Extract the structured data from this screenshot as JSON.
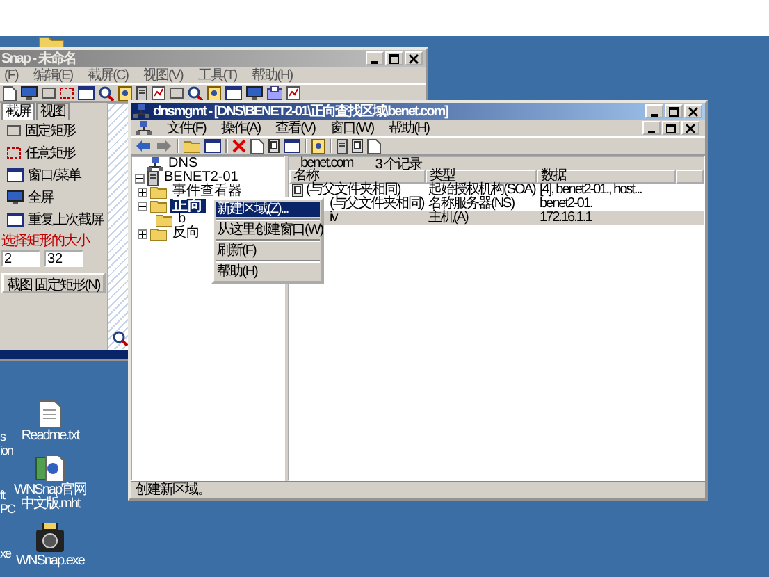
{
  "back_window": {
    "title": "Snap - 未命名",
    "menu": [
      "(F)",
      "编辑(E)",
      "截屏(C)",
      "视图(V)",
      "工具(T)",
      "帮助(H)"
    ],
    "tabs": [
      {
        "label": "截屏",
        "selected": true
      },
      {
        "label": "视图",
        "selected": false
      }
    ],
    "capture_items": [
      "固定矩形",
      "任意矩形",
      "窗口/菜单",
      "全屏",
      "重复上次截屏"
    ],
    "size_label": "选择矩形的大小",
    "width_value": "2",
    "height_value": "32",
    "capture_button": "截图 固定矩形(N)"
  },
  "dns_window": {
    "title": "dnsmgmt - [DNS\\BENET2-01\\正向查找区域\\benet.com]",
    "menu": [
      "文件(F)",
      "操作(A)",
      "查看(V)",
      "窗口(W)",
      "帮助(H)"
    ],
    "tree": [
      {
        "label": "DNS",
        "selected": false,
        "children": [
          {
            "label": "BENET2-01",
            "selected": false,
            "expanded": true,
            "children": [
              {
                "label": "事件查看器",
                "selected": false,
                "expanded": false
              },
              {
                "label": "正向",
                "selected": true,
                "expanded": true,
                "children": [
                  {
                    "label": "b",
                    "selected": false
                  }
                ]
              },
              {
                "label": "反向",
                "selected": false,
                "expanded": false
              }
            ]
          }
        ]
      }
    ],
    "list_header": "benet.com",
    "record_count": "3 个记录",
    "columns": [
      "名称",
      "类型",
      "数据"
    ],
    "rows": [
      {
        "cells": [
          "(与父文件夹相同)",
          "起始授权机构(SOA)",
          "[4], benet2-01., host..."
        ],
        "icon": true,
        "selected": false
      },
      {
        "cells": [
          "(与父文件夹相同)",
          "名称服务器(NS)",
          "benet2-01."
        ],
        "icon": false,
        "selected": false
      },
      {
        "cells": [
          "iv",
          "主机(A)",
          "172.16.1.1"
        ],
        "icon": false,
        "selected": true
      }
    ],
    "context_menu": [
      {
        "label": "新建区域(Z)...",
        "selected": true
      },
      {
        "label": "从这里创建窗口(W)",
        "selected": false
      },
      {
        "label": "刷新(F)",
        "selected": false
      },
      {
        "label": "帮助(H)",
        "selected": false
      }
    ],
    "status": "创建新区域。"
  },
  "desktop_icons": [
    {
      "label": "Readme.txt",
      "kind": "text"
    },
    {
      "label": "WNSnap官网中文版.mht",
      "kind": "web"
    },
    {
      "label": "WNSnap.exe",
      "kind": "camera"
    }
  ],
  "cut_icon_labels": [
    [
      "s",
      "ion"
    ],
    [
      "ft",
      "PC"
    ],
    [
      "xe"
    ]
  ]
}
